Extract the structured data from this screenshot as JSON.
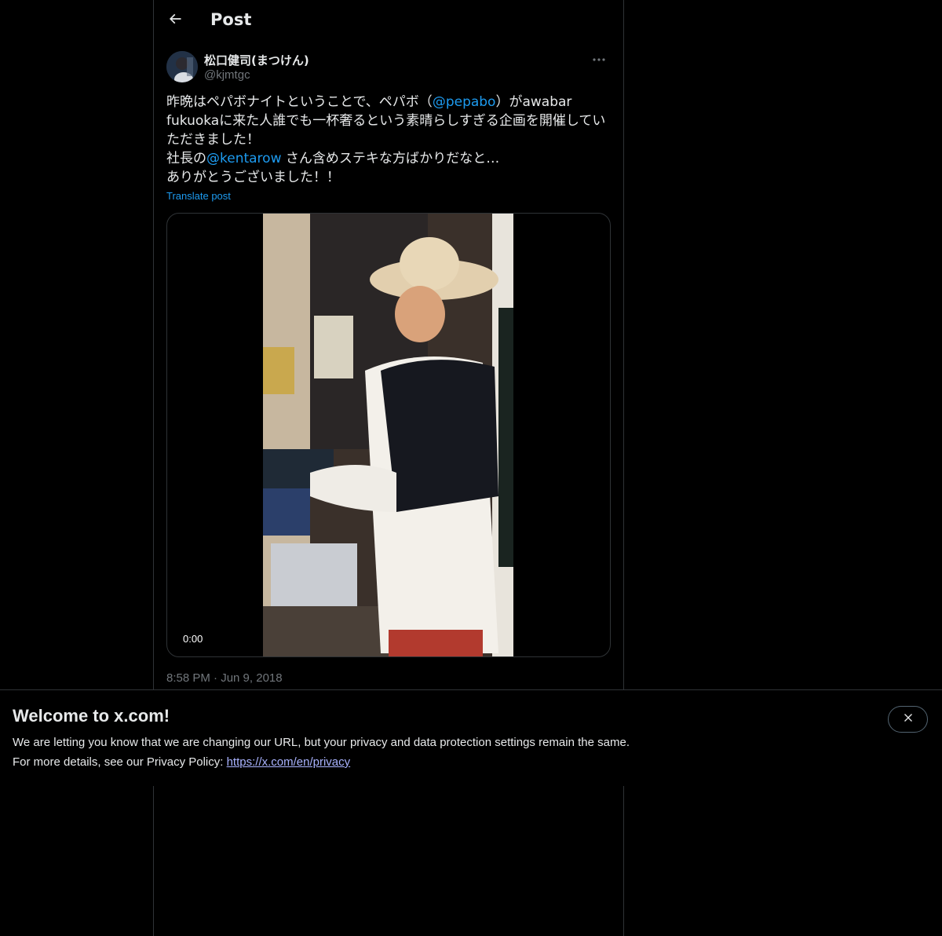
{
  "header": {
    "title": "Post",
    "back_icon": "arrow-left-icon"
  },
  "post": {
    "author_name": "松口健司(まつけん)",
    "author_handle": "@kjmtgc",
    "more_icon": "more-horizontal-icon",
    "text": {
      "line1_a": "昨晩はペパボナイトということで、ペパボ（",
      "mention1": "@pepabo",
      "line1_b": "）がawabar",
      "line2": "fukuokaに来た人誰でも一杯奢るという素晴らしすぎる企画を開催してい",
      "line3": "ただきました！",
      "line4_a": "社長の",
      "mention2": "@kentarow",
      "line4_b": " さん含めステキな方ばかりだなと…",
      "line5": "ありがとうございました！！"
    },
    "translate_label": "Translate post",
    "video": {
      "duration": "0:00"
    },
    "timestamp": "8:58 PM · Jun 9, 2018"
  },
  "banner": {
    "title": "Welcome to x.com!",
    "line1": "We are letting you know that we are changing our URL, but your privacy and data protection settings remain the same.",
    "line2_prefix": "For more details, see our Privacy Policy: ",
    "link": "https://x.com/en/privacy",
    "close_icon": "close-icon"
  },
  "colors": {
    "background": "#000000",
    "text": "#e7e9ea",
    "secondary": "#71767b",
    "accent": "#1d9bf0",
    "border": "#2f3336"
  }
}
